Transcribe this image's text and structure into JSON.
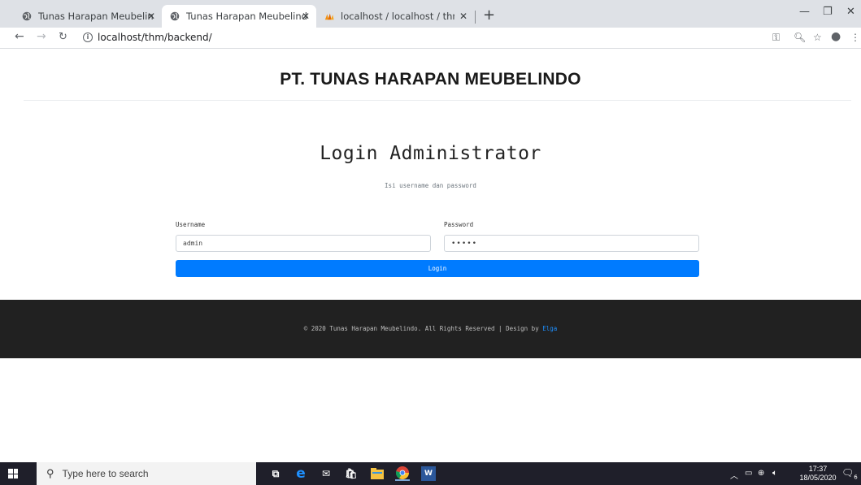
{
  "browser": {
    "tabs": [
      {
        "title": "Tunas Harapan Meubelindo",
        "active": false
      },
      {
        "title": "Tunas Harapan Meubelindo",
        "active": true
      },
      {
        "title": "localhost / localhost / thm / surv",
        "active": false
      }
    ],
    "url": "localhost/thm/backend/"
  },
  "header": {
    "brand": "PT. TUNAS HARAPAN MEUBELINDO"
  },
  "login": {
    "title": "Login Administrator",
    "subtitle": "Isi username dan password",
    "username_label": "Username",
    "username_value": "admin",
    "password_label": "Password",
    "password_value": "•••••",
    "button_label": "Login"
  },
  "footer": {
    "text": "© 2020 Tunas Harapan Meubelindo. All Rights Reserved | Design by",
    "link_text": "Elga"
  },
  "taskbar": {
    "search_placeholder": "Type here to search",
    "time": "17:37",
    "date": "18/05/2020",
    "notification_count": "6"
  },
  "colors": {
    "primary": "#007bff",
    "footer_bg": "#212121",
    "taskbar_bg": "#1f1f2a"
  }
}
